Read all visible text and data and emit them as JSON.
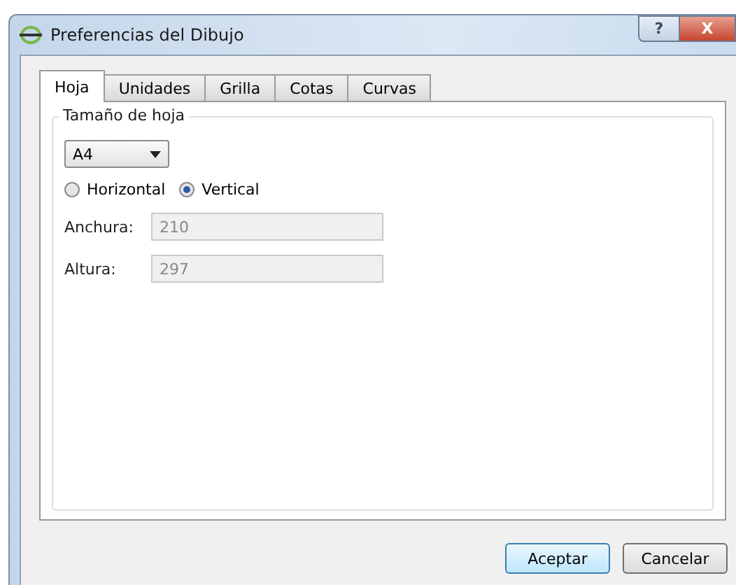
{
  "window": {
    "title": "Preferencias del Dibujo",
    "help": "?",
    "close": "X"
  },
  "tabs": [
    {
      "label": "Hoja",
      "selected": true
    },
    {
      "label": "Unidades",
      "selected": false
    },
    {
      "label": "Grilla",
      "selected": false
    },
    {
      "label": "Cotas",
      "selected": false
    },
    {
      "label": "Curvas",
      "selected": false
    }
  ],
  "group": {
    "title": "Tamaño de hoja",
    "paper_size": {
      "value": "A4"
    },
    "orientation": [
      {
        "label": "Horizontal",
        "selected": false
      },
      {
        "label": "Vertical",
        "selected": true
      }
    ],
    "fields": [
      {
        "label": "Anchura:",
        "value": "210",
        "disabled": true
      },
      {
        "label": "Altura:",
        "value": "297",
        "disabled": true
      }
    ]
  },
  "buttons": [
    {
      "label": "Aceptar",
      "default": true
    },
    {
      "label": "Cancelar",
      "default": false
    }
  ]
}
